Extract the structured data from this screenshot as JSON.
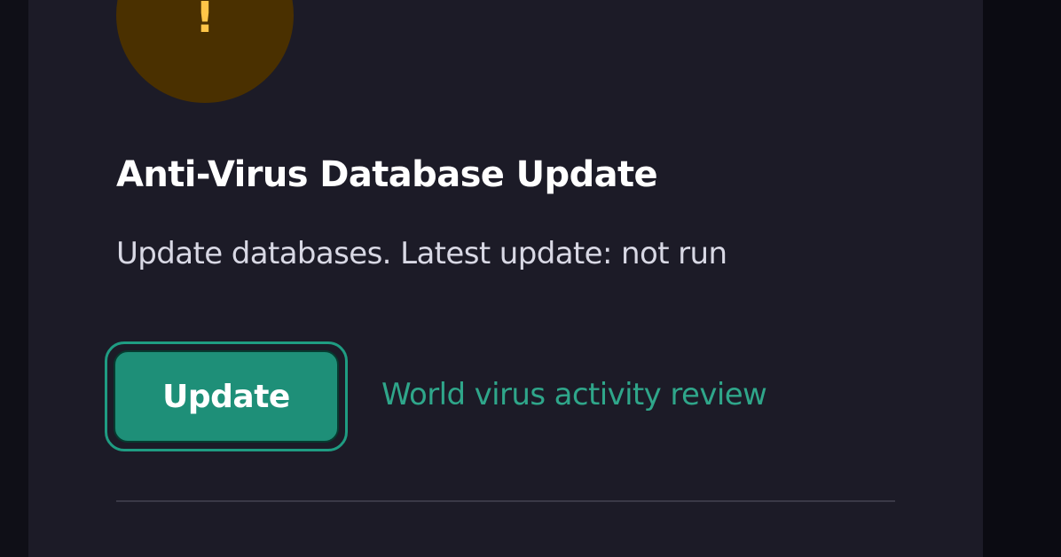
{
  "card": {
    "status_icon": "warning-exclamation-icon",
    "status_symbol": "!",
    "title": "Anti-Virus Database Update",
    "description": "Update databases. Latest update: not run",
    "update_button_label": "Update",
    "review_link_label": "World virus activity review"
  },
  "colors": {
    "page_background": "#0f0f17",
    "panel_background": "#1c1b27",
    "warning_circle": "#4a3000",
    "warning_mark": "#ffc548",
    "accent": "#1e8f78",
    "link": "#2fa68a"
  }
}
